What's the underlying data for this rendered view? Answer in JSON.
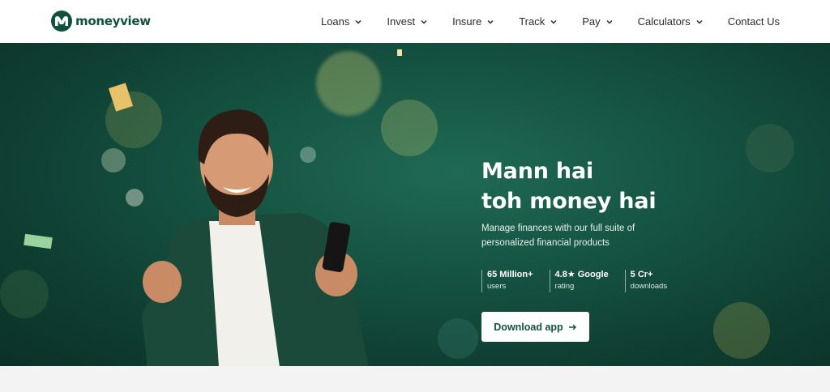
{
  "brand": {
    "name": "moneyview",
    "color": "#10523c"
  },
  "nav": {
    "items": [
      {
        "label": "Loans",
        "has_dropdown": true
      },
      {
        "label": "Invest",
        "has_dropdown": true
      },
      {
        "label": "Insure",
        "has_dropdown": true
      },
      {
        "label": "Track",
        "has_dropdown": true
      },
      {
        "label": "Pay",
        "has_dropdown": true
      },
      {
        "label": "Calculators",
        "has_dropdown": true
      },
      {
        "label": "Contact Us",
        "has_dropdown": false
      }
    ]
  },
  "hero": {
    "headline_line1": "Mann hai",
    "headline_line2": "toh money hai",
    "subtitle": "Manage finances with our full suite of personalized financial products",
    "stats": [
      {
        "value": "65 Million+",
        "label": "users"
      },
      {
        "value": "4.8★ Google",
        "label": "rating"
      },
      {
        "value": "5 Cr+",
        "label": "downloads"
      }
    ],
    "cta_label": "Download app",
    "cta_icon": "arrow-right-icon"
  },
  "colors": {
    "hero_bg": "#165543",
    "cta_text": "#10523c"
  }
}
